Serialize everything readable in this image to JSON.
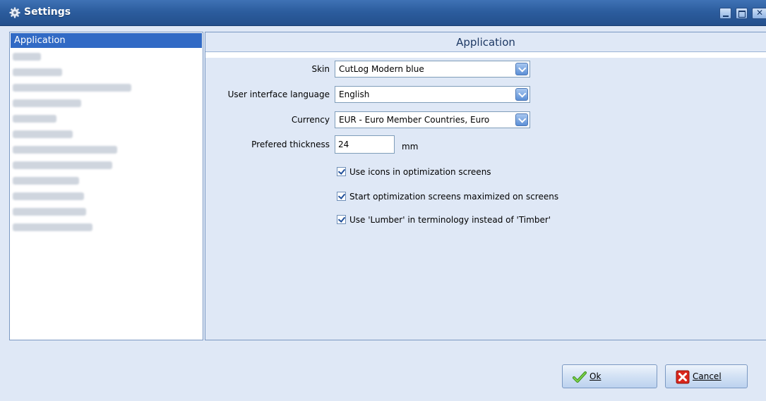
{
  "window": {
    "title": "Settings",
    "icon": "gear-icon"
  },
  "sidebar": {
    "selected_label": "Application",
    "blurred_item_count": 13
  },
  "panel": {
    "header": "Application",
    "skin": {
      "label": "Skin",
      "value": "CutLog Modern blue"
    },
    "language": {
      "label": "User interface language",
      "value": "English"
    },
    "currency": {
      "label": "Currency",
      "value": "EUR - Euro Member Countries, Euro"
    },
    "thickness": {
      "label": "Prefered thickness",
      "value": "24",
      "unit": "mm"
    },
    "checkboxes": [
      {
        "label": "Use icons in optimization screens",
        "checked": true
      },
      {
        "label": "Start optimization screens maximized on screens",
        "checked": true
      },
      {
        "label": "Use 'Lumber' in terminology instead of 'Timber'",
        "checked": true
      }
    ]
  },
  "buttons": {
    "ok_label": "Ok",
    "cancel_label": "Cancel"
  },
  "colors": {
    "accent": "#316ac5",
    "title_bar": "#2c5d9e",
    "panel_bg": "#dfe8f6"
  }
}
